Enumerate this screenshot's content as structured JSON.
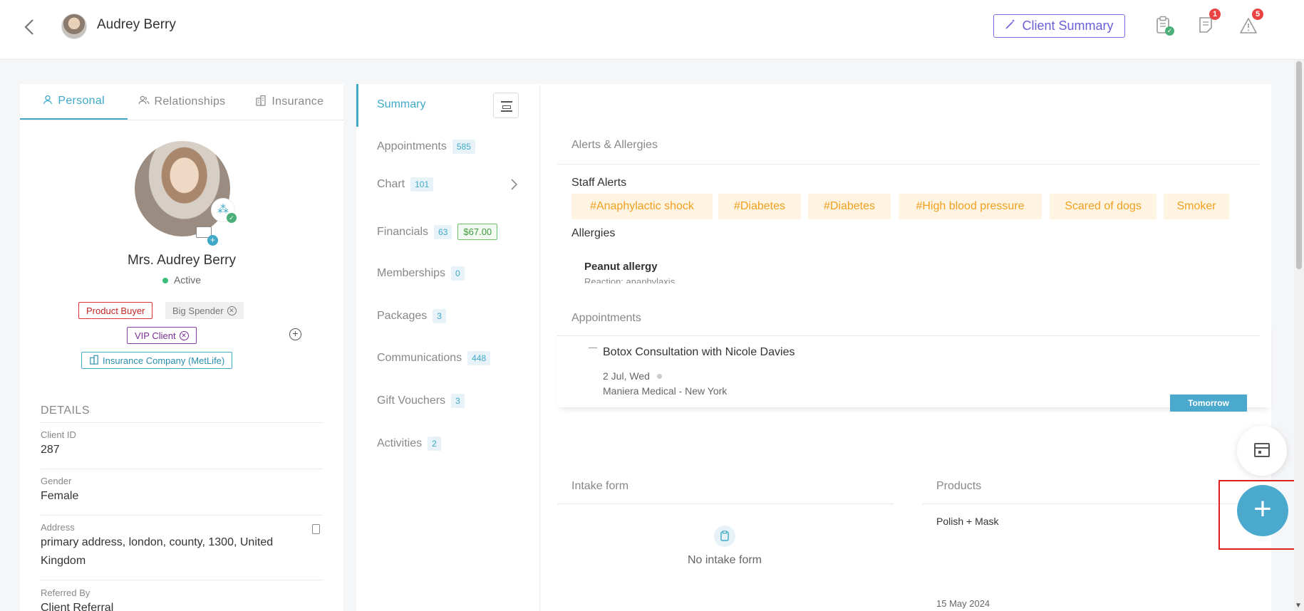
{
  "header": {
    "client_name": "Audrey Berry",
    "client_summary_label": "Client Summary",
    "notes_badge": "1",
    "alerts_badge": "5"
  },
  "profile": {
    "tabs": [
      "Personal",
      "Relationships",
      "Insurance"
    ],
    "full_name": "Mrs. Audrey Berry",
    "status": "Active",
    "tags": {
      "product_buyer": "Product Buyer",
      "big_spender": "Big Spender",
      "vip_client": "VIP Client",
      "insurance": "Insurance Company (MetLife)"
    },
    "details_heading": "DETAILS",
    "client_id_label": "Client ID",
    "client_id": "287",
    "gender_label": "Gender",
    "gender": "Female",
    "address_label": "Address",
    "address": "primary address, london, county, 1300, United Kingdom",
    "referred_label": "Referred By",
    "referred": "Client Referral"
  },
  "nav": {
    "summary": "Summary",
    "items": [
      {
        "label": "Appointments",
        "count": "585"
      },
      {
        "label": "Chart",
        "count": "101"
      },
      {
        "label": "Financials",
        "count": "63",
        "amount": "$67.00"
      },
      {
        "label": "Memberships",
        "count": "0"
      },
      {
        "label": "Packages",
        "count": "3"
      },
      {
        "label": "Communications",
        "count": "448"
      },
      {
        "label": "Gift Vouchers",
        "count": "3"
      },
      {
        "label": "Activities",
        "count": "2"
      }
    ]
  },
  "summary": {
    "alerts_heading": "Alerts & Allergies",
    "staff_alerts_heading": "Staff Alerts",
    "staff_alerts": [
      "#Anaphylactic shock",
      "#Diabetes",
      "#Diabetes",
      "#High blood pressure",
      "Scared of dogs",
      "Smoker"
    ],
    "allergies_heading": "Allergies",
    "allergy_name": "Peanut allergy",
    "allergy_reaction": "Reaction: anaphylaxis",
    "appointments_heading": "Appointments",
    "appointment_title": "Botox Consultation with Nicole Davies",
    "appointment_date": "2 Jul, Wed",
    "appointment_location": "Maniera Medical - New York",
    "appointment_badge": "Tomorrow",
    "intake_heading": "Intake form",
    "intake_empty": "No intake form",
    "products_heading": "Products",
    "product_item": "Polish + Mask",
    "product_date": "15 May 2024"
  },
  "colors": {
    "accent": "#3fa9c7",
    "client_summary": "#6b5fd8",
    "alert_chip_bg": "#fff4e1",
    "alert_chip_text": "#f0a020",
    "fab": "#4aa9cd",
    "highlight": "#e02020"
  },
  "icons": [
    "back-arrow-icon",
    "wand-icon",
    "clipboard-check-icon",
    "notes-icon",
    "warning-icon",
    "person-icon",
    "relationships-icon",
    "building-icon",
    "calendar-icon",
    "plus-icon"
  ]
}
